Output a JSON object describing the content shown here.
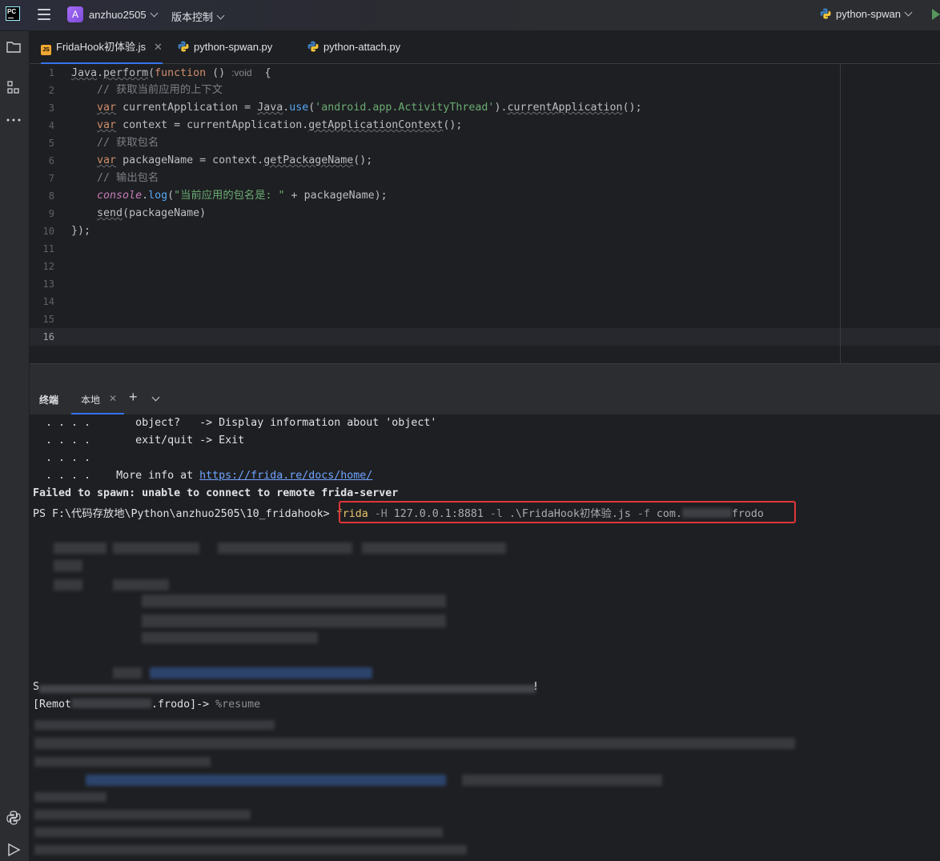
{
  "titlebar": {
    "app_logo": "PC",
    "project_badge": "A",
    "project_name": "anzhuo2505",
    "vcs_label": "版本控制",
    "run_config": "python-spwan"
  },
  "tabs": [
    {
      "label": "FridaHook初体验.js",
      "icon": "js-file-icon",
      "active": true,
      "closable": true
    },
    {
      "label": "python-spwan.py",
      "icon": "python-file-icon",
      "active": false
    },
    {
      "label": "python-attach.py",
      "icon": "python-file-icon",
      "active": false
    }
  ],
  "editor": {
    "line_numbers": [
      "1",
      "2",
      "3",
      "4",
      "5",
      "6",
      "7",
      "8",
      "9",
      "10",
      "11",
      "12",
      "13",
      "14",
      "15",
      "16"
    ],
    "current_line": 16,
    "code": {
      "l1_a": "Java",
      "l1_b": ".",
      "l1_c": "perform",
      "l1_d": "(",
      "l1_e": "function",
      "l1_f": " () ",
      "l1_hint": ":void",
      "l1_g": "  {",
      "l2": "    // 获取当前应用的上下文",
      "l3_a": "    ",
      "l3_var": "var",
      "l3_b": " currentApplication = ",
      "l3_java": "Java",
      "l3_c": ".",
      "l3_use": "use",
      "l3_d": "(",
      "l3_str": "'android.app.ActivityThread'",
      "l3_e": ").",
      "l3_ca": "currentApplication",
      "l3_f": "();",
      "l4_a": "    ",
      "l4_var": "var",
      "l4_b": " context = currentApplication.",
      "l4_fn": "getApplicationContext",
      "l4_c": "();",
      "l5": "    // 获取包名",
      "l6_a": "    ",
      "l6_var": "var",
      "l6_b": " packageName = context.",
      "l6_fn": "getPackageName",
      "l6_c": "();",
      "l7": "    // 输出包名",
      "l8_a": "    ",
      "l8_console": "console",
      "l8_b": ".",
      "l8_log": "log",
      "l8_c": "(",
      "l8_str": "\"当前应用的包名是: \"",
      "l8_d": " + packageName);",
      "l9_a": "    ",
      "l9_send": "send",
      "l9_b": "(packageName)",
      "l10": "});"
    }
  },
  "terminal": {
    "title": "终端",
    "tab_label": "本地",
    "lines": {
      "t1": "  . . . .       object?   -> Display information about 'object'",
      "t2": "  . . . .       exit/quit -> Exit",
      "t3": "  . . . .",
      "t4a": "  . . . .    More info at ",
      "t4link": "https://frida.re/docs/home/",
      "t5": "Failed to spawn: unable to connect to remote frida-server",
      "prompt": "PS F:\\代码存放地\\Python\\anzhuo2505\\10_fridahook> ",
      "cmd_frida": "frida",
      "cmd_h": " -H ",
      "cmd_host": "127.0.0.1:8881",
      "cmd_l": " -l ",
      "cmd_file": ".\\FridaHook初体验.js",
      "cmd_f": " -f ",
      "cmd_pkg_a": "com.",
      "cmd_pkg_b": "frodo",
      "remote_a": "[Remot",
      "remote_b": ".frodo]-> ",
      "remote_cmd": "%resume",
      "s_prefix": "S",
      "bang": "!"
    }
  }
}
